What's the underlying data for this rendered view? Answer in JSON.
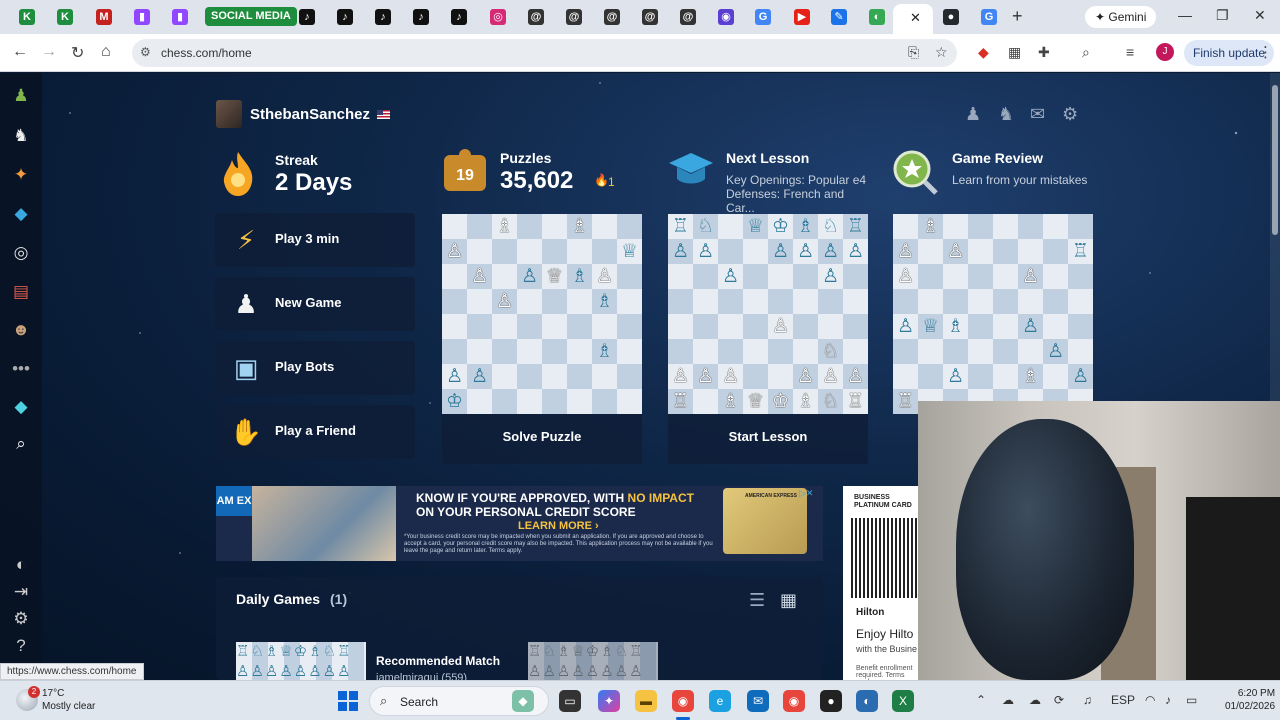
{
  "browser": {
    "tabs": [
      {
        "icon": "k-green-icon",
        "glyph": "K",
        "color": "#1e8e3e"
      },
      {
        "icon": "k-green-icon",
        "glyph": "K",
        "color": "#1e8e3e"
      },
      {
        "icon": "gmail-icon",
        "glyph": "M",
        "color": "#c5221f"
      },
      {
        "icon": "twitch-icon",
        "glyph": "▮",
        "color": "#9146ff"
      },
      {
        "icon": "twitch-icon",
        "glyph": "▮",
        "color": "#9146ff"
      },
      {
        "icon": "tiktok-icon",
        "glyph": "♪",
        "color": "#111111"
      },
      {
        "icon": "tiktok-icon",
        "glyph": "♪",
        "color": "#111111"
      },
      {
        "icon": "tiktok-icon",
        "glyph": "♪",
        "color": "#111111"
      },
      {
        "icon": "tiktok-icon",
        "glyph": "♪",
        "color": "#111111"
      },
      {
        "icon": "tiktok-icon",
        "glyph": "♪",
        "color": "#111111"
      },
      {
        "icon": "instagram-icon",
        "glyph": "◎",
        "color": "#d62976"
      },
      {
        "icon": "threads-icon",
        "glyph": "@",
        "color": "#333333"
      },
      {
        "icon": "threads-icon",
        "glyph": "@",
        "color": "#333333"
      },
      {
        "icon": "threads-icon",
        "glyph": "@",
        "color": "#333333"
      },
      {
        "icon": "threads-icon",
        "glyph": "@",
        "color": "#333333"
      },
      {
        "icon": "threads-icon",
        "glyph": "@",
        "color": "#333333"
      },
      {
        "icon": "app-icon",
        "glyph": "◉",
        "color": "#5b3fd1"
      },
      {
        "icon": "google-icon",
        "glyph": "G",
        "color": "#4285f4"
      },
      {
        "icon": "youtube-icon",
        "glyph": "▶",
        "color": "#e62117"
      },
      {
        "icon": "edit-icon",
        "glyph": "✎",
        "color": "#1a73e8"
      },
      {
        "icon": "chrome-icon",
        "glyph": "◐",
        "color": "#34a853"
      },
      {
        "icon": "github-icon",
        "glyph": "●",
        "color": "#24292e"
      },
      {
        "icon": "google-icon",
        "glyph": "G",
        "color": "#4285f4"
      },
      {
        "icon": "whatsapp-icon",
        "glyph": "✆",
        "color": "#25d366"
      }
    ],
    "social_tab_label": "SOCIAL MEDIA",
    "gemini_label": "✦ Gemini",
    "url": "chess.com/home",
    "finish_update_label": "Finish update",
    "profile_initial": "J"
  },
  "page": {
    "username": "SthebanSanchez",
    "streak": {
      "label": "Streak",
      "value": "2 Days"
    },
    "menu": [
      {
        "label": "Play 3 min",
        "icon": "lightning-icon",
        "glyph": "⚡"
      },
      {
        "label": "New Game",
        "icon": "pawn-hand-icon",
        "glyph": "♟"
      },
      {
        "label": "Play Bots",
        "icon": "robot-icon",
        "glyph": "▣"
      },
      {
        "label": "Play a Friend",
        "icon": "handshake-icon",
        "glyph": "✋"
      }
    ],
    "cards": {
      "puzzles": {
        "title": "Puzzles",
        "value": "35,602",
        "badge": "19",
        "extra": "1",
        "footer": "Solve Puzzle"
      },
      "lesson": {
        "title": "Next Lesson",
        "sub1": "Key Openings: Popular e4",
        "sub2": "Defenses: French and Car...",
        "footer": "Start Lesson"
      },
      "review": {
        "title": "Game Review",
        "sub": "Learn from your mistakes"
      }
    },
    "boards": {
      "puzzle": [
        "  ♗  ♗ ",
        "♙      ♕",
        " ♙ ♙♕♗♙ ",
        "  ♙   ♗ ",
        "        ",
        "      ♗ ",
        "♙♙      ",
        "♔       "
      ],
      "lesson": [
        "♖♘ ♕♔♗♘♖",
        "♙♙  ♙♙♙♙",
        "  ♙   ♙ ",
        "        ",
        "    ♙   ",
        "      ♘ ",
        "♙♙♙  ♙♙♙",
        "♖ ♗♕♔♗♘♖"
      ],
      "review": [
        " ♗      ",
        "♙ ♙    ♖",
        "♙    ♙  ",
        "        ",
        "♙♕♗  ♙  ",
        "      ♙ ",
        "  ♙  ♗ ♙",
        "♖       "
      ],
      "puzzle_colors": [
        "  ww  w ",
        "w      b",
        " w bwbw ",
        "  w   b ",
        "        ",
        "      b ",
        "bb      ",
        "b       "
      ],
      "lesson_colors": [
        "bb bbbbb",
        "bb  bbbb",
        "  b   b ",
        "        ",
        "    w   ",
        "      w ",
        "www  www",
        "w wwwwww"
      ],
      "review_colors": [
        " w      ",
        "w w    b",
        "w    w  ",
        "        ",
        "bbb  b  ",
        "      b ",
        "  b  w b",
        "w       "
      ]
    },
    "ad": {
      "brand": "AM EX",
      "headline1_a": "KNOW IF YOU'RE APPROVED, WITH ",
      "headline1_b": "NO IMPACT",
      "headline2": "ON YOUR PERSONAL CREDIT SCORE",
      "cta": "LEARN MORE ›",
      "fine": "*Your business credit score may be impacted when you submit an application. If you are approved and choose to accept a card, your personal credit score may also be impacted. This application process may not be available if you leave the page and return later. Terms apply.",
      "card_text": "AMERICAN EXPRESS"
    },
    "ad2": {
      "title": "BUSINESS PLATINUM CARD",
      "brand": "Hilton",
      "headline": "Enjoy Hilto",
      "sub": "with the Busine",
      "fine": "Benefit enrollment required. Terms apply."
    },
    "daily": {
      "title": "Daily Games",
      "count": "(1)",
      "rec_title": "Recommended Match",
      "rec_sub": "iamelmiraqui (559)"
    },
    "status_url": "https://www.chess.com/home"
  },
  "taskbar": {
    "temp": "17°C",
    "condition": "Mostly clear",
    "weather_badge": "2",
    "search_label": "Search",
    "lang": "ESP",
    "time": "6:20 PM",
    "date": "01/02/2026"
  }
}
